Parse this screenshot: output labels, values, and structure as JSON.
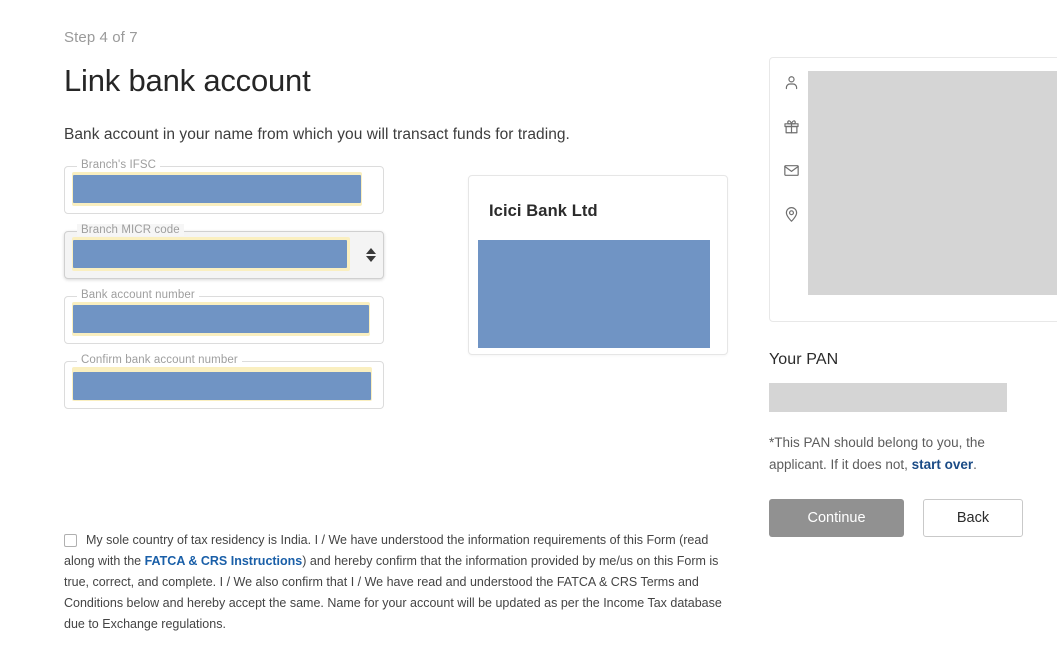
{
  "header": {
    "step_label": "Step 4 of 7",
    "title": "Link bank account",
    "subtitle": "Bank account in your name from which you will transact funds for trading."
  },
  "form": {
    "fields": [
      {
        "label": "Branch's IFSC",
        "value": "",
        "type": "text",
        "redacted": true
      },
      {
        "label": "Branch MICR code",
        "value": "",
        "type": "number",
        "redacted": true
      },
      {
        "label": "Bank account number",
        "value": "",
        "type": "text",
        "redacted": true
      },
      {
        "label": "Confirm bank account number",
        "value": "",
        "type": "text",
        "redacted": true
      }
    ]
  },
  "bank_card": {
    "bank_name": "Icici Bank Ltd",
    "details_redacted": true
  },
  "consent": {
    "text_before_link": "My sole country of tax residency is India. I / We have understood the information requirements of this Form (read along with the ",
    "link_text": "FATCA & CRS Instructions",
    "text_after_link": ") and hereby confirm that the information provided by me/us on this Form is true, correct, and complete. I / We also confirm that I / We have read and understood the FATCA & CRS Terms and Conditions below and hereby accept the same. Name for your account will be updated as per the Income Tax database due to Exchange regulations.",
    "checked": false
  },
  "aside": {
    "profile_icons": [
      "person-icon",
      "gift-icon",
      "envelope-icon",
      "location-pin-icon"
    ],
    "profile_redacted": true,
    "pan_title": "Your PAN",
    "pan_value": "",
    "pan_note_before_link": "*This PAN should belong to you, the applicant. If it does not, ",
    "pan_note_link": "start over",
    "pan_note_after_link": ".",
    "continue_label": "Continue",
    "back_label": "Back"
  },
  "colors": {
    "redaction_blue": "#7094c4",
    "redaction_gray": "#d5d5d5",
    "link_blue": "#1a4b86",
    "instructions_link_blue": "#1a5fa8",
    "continue_disabled_gray": "#919191",
    "autofill_yellow": "#faefc0"
  }
}
